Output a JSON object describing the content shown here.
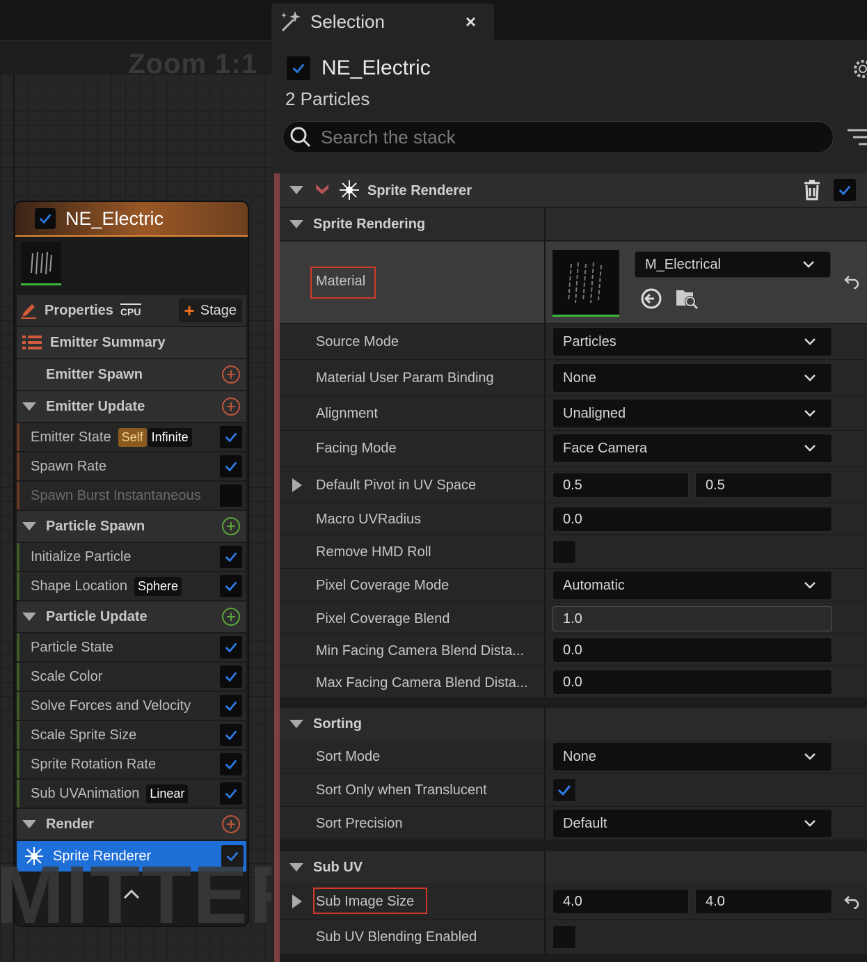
{
  "graph": {
    "zoom_label": "Zoom 1:1",
    "watermark": "MITTER",
    "node": {
      "title": "NE_Electric",
      "properties_label": "Properties",
      "cpu_label": "CPU",
      "stage_label": "Stage",
      "summary_label": "Emitter Summary",
      "sections": {
        "emitter_spawn": "Emitter Spawn",
        "emitter_update": "Emitter Update",
        "particle_spawn": "Particle Spawn",
        "particle_update": "Particle Update",
        "render": "Render"
      },
      "emitter_update_modules": [
        {
          "label": "Emitter State",
          "tags": [
            "Self",
            "Infinite"
          ],
          "enabled": true
        },
        {
          "label": "Spawn Rate",
          "enabled": true
        },
        {
          "label": "Spawn Burst Instantaneous",
          "enabled": false
        }
      ],
      "particle_spawn_modules": [
        {
          "label": "Initialize Particle",
          "enabled": true
        },
        {
          "label": "Shape Location",
          "tag": "Sphere",
          "enabled": true
        }
      ],
      "particle_update_modules": [
        {
          "label": "Particle State",
          "enabled": true
        },
        {
          "label": "Scale Color",
          "enabled": true
        },
        {
          "label": "Solve Forces and Velocity",
          "enabled": true
        },
        {
          "label": "Scale Sprite Size",
          "enabled": true
        },
        {
          "label": "Sprite Rotation Rate",
          "enabled": true
        },
        {
          "label": "Sub UVAnimation",
          "tag": "Linear",
          "enabled": true
        }
      ],
      "render_item": "Sprite Renderer"
    }
  },
  "panel": {
    "tab_title": "Selection",
    "tab_close": "×",
    "emitter_name": "NE_Electric",
    "particle_count": "2 Particles",
    "search_placeholder": "Search the stack",
    "renderer_title": "Sprite Renderer",
    "groups": {
      "sprite_rendering": "Sprite Rendering",
      "sorting": "Sorting",
      "sub_uv": "Sub UV"
    },
    "material": {
      "label": "Material",
      "value": "M_Electrical"
    },
    "properties": {
      "source_mode": {
        "label": "Source Mode",
        "value": "Particles"
      },
      "material_user_param": {
        "label": "Material User Param Binding",
        "value": "None"
      },
      "alignment": {
        "label": "Alignment",
        "value": "Unaligned"
      },
      "facing_mode": {
        "label": "Facing Mode",
        "value": "Face Camera"
      },
      "default_pivot": {
        "label": "Default Pivot in UV Space",
        "x": "0.5",
        "y": "0.5"
      },
      "macro_uvradius": {
        "label": "Macro UVRadius",
        "value": "0.0"
      },
      "remove_hmd_roll": {
        "label": "Remove HMD Roll",
        "checked": false
      },
      "pixel_coverage_mode": {
        "label": "Pixel Coverage Mode",
        "value": "Automatic"
      },
      "pixel_coverage_blend": {
        "label": "Pixel Coverage Blend",
        "value": "1.0"
      },
      "min_facing": {
        "label": "Min Facing Camera Blend Dista...",
        "value": "0.0"
      },
      "max_facing": {
        "label": "Max Facing Camera Blend Dista...",
        "value": "0.0"
      },
      "sort_mode": {
        "label": "Sort Mode",
        "value": "None"
      },
      "sort_only_translucent": {
        "label": "Sort Only when Translucent",
        "checked": true
      },
      "sort_precision": {
        "label": "Sort Precision",
        "value": "Default"
      },
      "sub_image_size": {
        "label": "Sub Image Size",
        "x": "4.0",
        "y": "4.0"
      },
      "sub_uv_blending": {
        "label": "Sub UV Blending Enabled",
        "checked": false
      }
    }
  },
  "colors": {
    "accent_blue": "#1f6fd9",
    "check_blue": "#2d7be8",
    "highlight_red": "#d13a2a",
    "emitter_orange": "#e18a3a"
  }
}
